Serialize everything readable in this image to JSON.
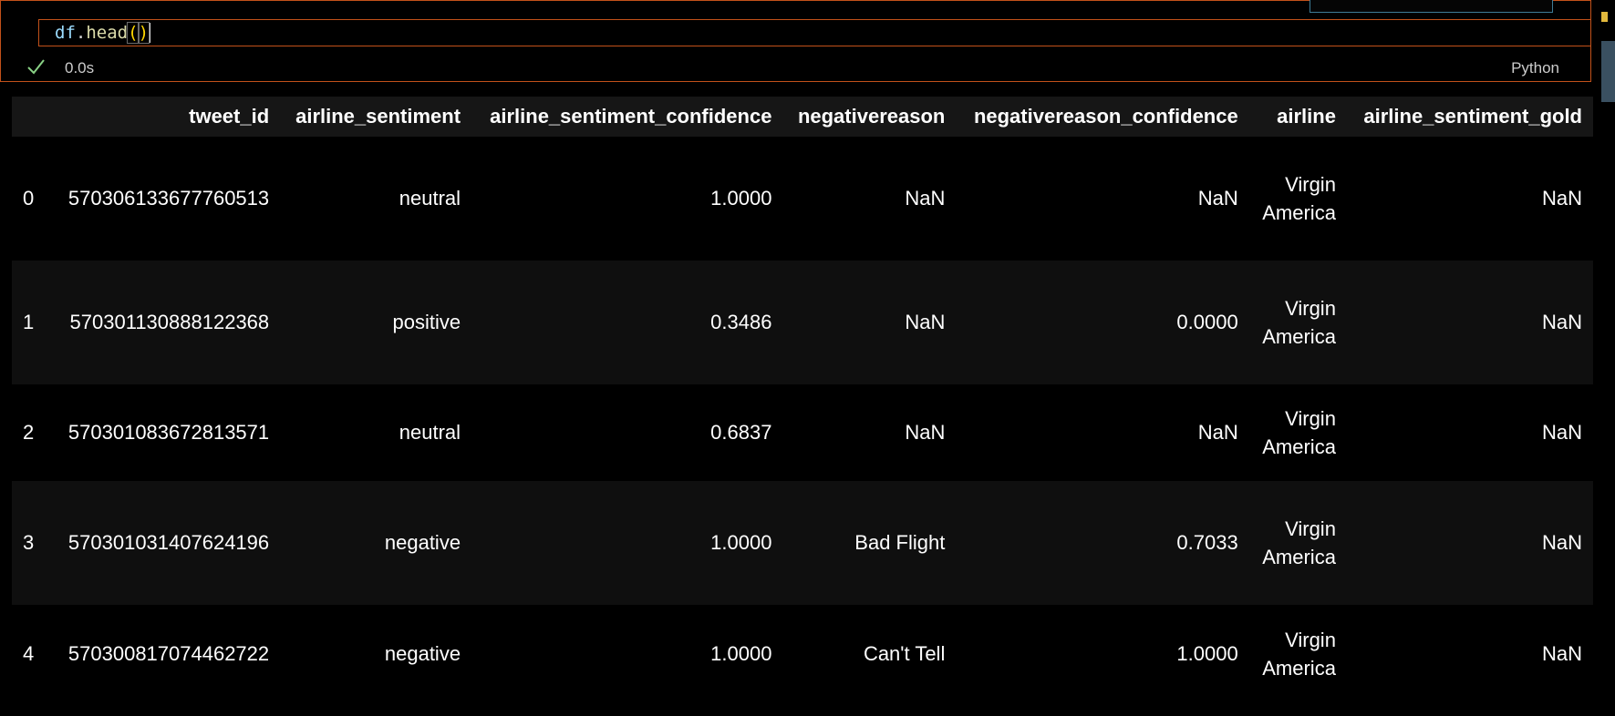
{
  "cell": {
    "code": {
      "ident": "df",
      "dot": ".",
      "func": "head",
      "open_paren": "(",
      "close_paren": ")"
    },
    "exec_time": "0.0s",
    "kernel_lang": "Python",
    "status_icon": "check-icon"
  },
  "table": {
    "columns": [
      "tweet_id",
      "airline_sentiment",
      "airline_sentiment_confidence",
      "negativereason",
      "negativereason_confidence",
      "airline",
      "airline_sentiment_gold"
    ],
    "rows": [
      {
        "index": "0",
        "tweet_id": "570306133677760513",
        "airline_sentiment": "neutral",
        "airline_sentiment_confidence": "1.0000",
        "negativereason": "NaN",
        "negativereason_confidence": "NaN",
        "airline_1": "Virgin",
        "airline_2": "America",
        "airline_sentiment_gold": "NaN"
      },
      {
        "index": "1",
        "tweet_id": "570301130888122368",
        "airline_sentiment": "positive",
        "airline_sentiment_confidence": "0.3486",
        "negativereason": "NaN",
        "negativereason_confidence": "0.0000",
        "airline_1": "Virgin",
        "airline_2": "America",
        "airline_sentiment_gold": "NaN"
      },
      {
        "index": "2",
        "tweet_id": "570301083672813571",
        "airline_sentiment": "neutral",
        "airline_sentiment_confidence": "0.6837",
        "negativereason": "NaN",
        "negativereason_confidence": "NaN",
        "airline_1": "Virgin",
        "airline_2": "America",
        "airline_sentiment_gold": "NaN"
      },
      {
        "index": "3",
        "tweet_id": "570301031407624196",
        "airline_sentiment": "negative",
        "airline_sentiment_confidence": "1.0000",
        "negativereason": "Bad Flight",
        "negativereason_confidence": "0.7033",
        "airline_1": "Virgin",
        "airline_2": "America",
        "airline_sentiment_gold": "NaN"
      },
      {
        "index": "4",
        "tweet_id": "570300817074462722",
        "airline_sentiment": "negative",
        "airline_sentiment_confidence": "1.0000",
        "negativereason": "Can't Tell",
        "negativereason_confidence": "1.0000",
        "airline_1": "Virgin",
        "airline_2": "America",
        "airline_sentiment_gold": "NaN"
      }
    ]
  },
  "colors": {
    "cell_border": "#c2511a",
    "background": "#000000",
    "header_bg": "#161616",
    "row_alt_bg": "#0f0f0f",
    "check_color": "#89d185"
  }
}
